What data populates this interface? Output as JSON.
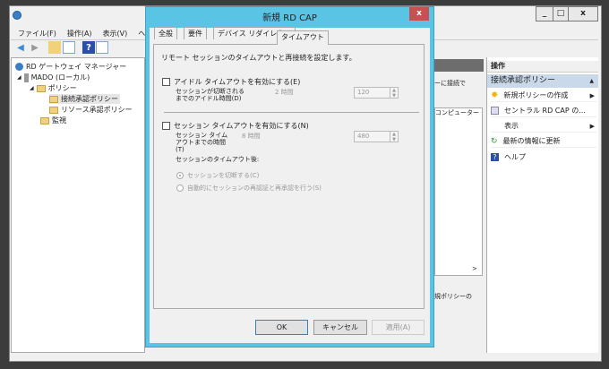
{
  "main_window": {
    "menu": [
      "ファイル(F)",
      "操作(A)",
      "表示(V)",
      "ヘル"
    ],
    "tree": [
      {
        "label": "RD ゲートウェイ マネージャー"
      },
      {
        "label": "MADO (ローカル)"
      },
      {
        "label": "ポリシー"
      },
      {
        "label": "接続承認ポリシー"
      },
      {
        "label": "リソース承認ポリシー"
      },
      {
        "label": "監視"
      }
    ],
    "middle_fragments": [
      "ーに接続で",
      "コンピューター グ.",
      "規ポリシーの"
    ],
    "actions": {
      "header": "操作",
      "section": "接続承認ポリシー",
      "items": [
        "新規ポリシーの作成",
        "セントラル RD CAP の...",
        "表示",
        "最新の情報に更新",
        "ヘルプ"
      ]
    }
  },
  "dialog": {
    "title": "新規 RD CAP",
    "close": "x",
    "tabs": [
      "全般",
      "要件",
      "デバイス リダイレクト",
      "タイムアウト"
    ],
    "description": "リモート セッションのタイムアウトと再接続を設定します。",
    "idle": {
      "checkbox": "アイドル タイムアウトを有効にする(E)",
      "label": "セッションが切断されるまでのアイドル時間(D)",
      "hint": "2 時間",
      "value": "120"
    },
    "session": {
      "checkbox": "セッション タイムアウトを有効にする(N)",
      "label": "セッション タイムアウトまでの時間(T)",
      "hint": "8 時間",
      "value": "480"
    },
    "after_label": "セッションのタイムアウト後:",
    "radios": [
      "セッションを切断する(C)",
      "自動的にセッションの再認証と再承認を行う(S)"
    ],
    "buttons": {
      "ok": "OK",
      "cancel": "キャンセル",
      "apply": "適用(A)"
    }
  }
}
